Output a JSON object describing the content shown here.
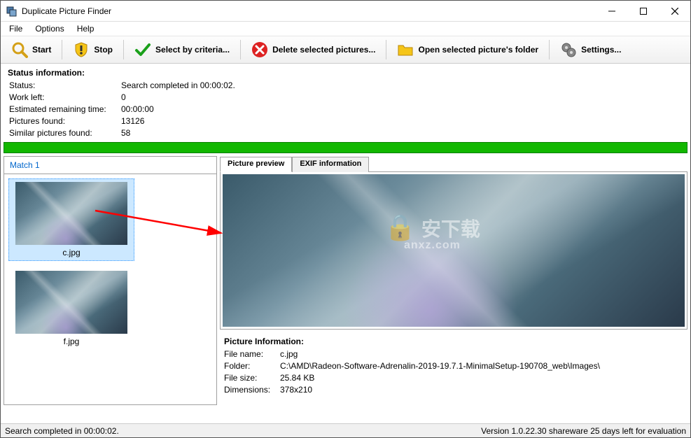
{
  "window": {
    "title": "Duplicate Picture Finder"
  },
  "menu": {
    "file": "File",
    "options": "Options",
    "help": "Help"
  },
  "toolbar": {
    "start": "Start",
    "stop": "Stop",
    "select_criteria": "Select by criteria...",
    "delete_selected": "Delete selected pictures...",
    "open_folder": "Open selected picture's folder",
    "settings": "Settings..."
  },
  "status": {
    "title": "Status information:",
    "labels": {
      "status": "Status:",
      "work_left": "Work left:",
      "eta": "Estimated remaining time:",
      "found": "Pictures found:",
      "similar": "Similar pictures found:"
    },
    "values": {
      "status": "Search completed in 00:00:02.",
      "work_left": "0",
      "eta": "00:00:00",
      "found": "13126",
      "similar": "58"
    }
  },
  "matches": {
    "tab_label": "Match 1",
    "items": [
      {
        "name": "c.jpg",
        "selected": true
      },
      {
        "name": "f.jpg",
        "selected": false
      }
    ]
  },
  "preview": {
    "tab_preview": "Picture preview",
    "tab_exif": "EXIF information",
    "watermark_main": "安下载",
    "watermark_sub": "anxz.com"
  },
  "picture_info": {
    "title": "Picture Information:",
    "labels": {
      "filename": "File name:",
      "folder": "Folder:",
      "filesize": "File size:",
      "dimensions": "Dimensions:"
    },
    "values": {
      "filename": "c.jpg",
      "folder": "C:\\AMD\\Radeon-Software-Adrenalin-2019-19.7.1-MinimalSetup-190708_web\\Images\\",
      "filesize": "25.84 KB",
      "dimensions": "378x210"
    }
  },
  "statusbar": {
    "left": "Search completed in 00:00:02.",
    "right": "Version 1.0.22.30 shareware 25 days left for evaluation"
  }
}
